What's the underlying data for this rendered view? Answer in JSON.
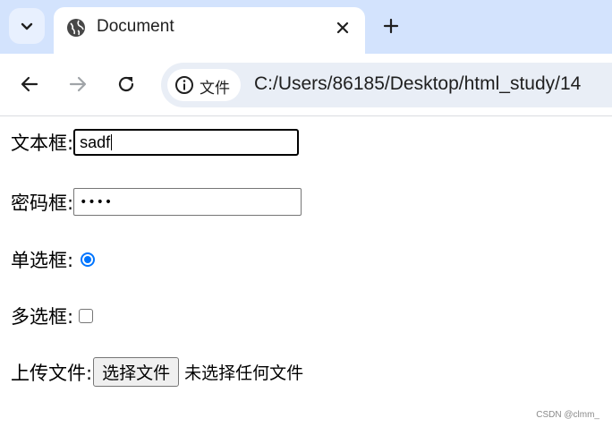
{
  "browser": {
    "tab": {
      "title": "Document"
    },
    "new_tab_glyph": "+",
    "address": {
      "chip_label": "文件",
      "url": "C:/Users/86185/Desktop/html_study/14"
    }
  },
  "form": {
    "textbox": {
      "label": "文本框:",
      "value": "sadf"
    },
    "password": {
      "label": "密码框:",
      "masked": "••••"
    },
    "radio": {
      "label": "单选框:",
      "checked": true
    },
    "checkbox": {
      "label": "多选框:",
      "checked": false
    },
    "file": {
      "label": "上传文件:",
      "button": "选择文件",
      "status": "未选择任何文件"
    }
  },
  "watermark": "CSDN @clmm_",
  "colors": {
    "tabbar": "#d3e3fd",
    "accent": "#0075ff",
    "omnibox": "#e9eef6"
  },
  "icons": [
    "chevron-down-icon",
    "globe-icon",
    "close-icon",
    "plus-icon",
    "back-arrow-icon",
    "forward-arrow-icon",
    "reload-icon",
    "info-icon"
  ]
}
